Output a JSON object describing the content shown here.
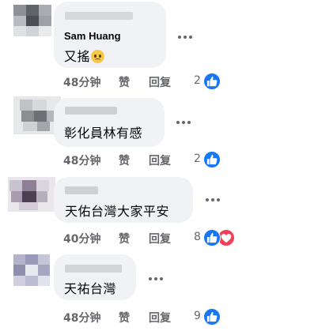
{
  "comments": [
    {
      "author": "Sam Huang",
      "text": "又搖",
      "emoji": "sad-face-emoji",
      "time": "48分钟",
      "like_label": "赞",
      "reply_label": "回复",
      "reaction_count": "2",
      "reactions": [
        "like"
      ]
    },
    {
      "author": "",
      "text": "彰化員林有感",
      "time": "48分钟",
      "like_label": "赞",
      "reply_label": "回复",
      "reaction_count": "2",
      "reactions": [
        "like"
      ]
    },
    {
      "author": "",
      "text": "天佑台灣大家平安",
      "time": "40分钟",
      "like_label": "赞",
      "reply_label": "回复",
      "reaction_count": "8",
      "reactions": [
        "like",
        "love"
      ]
    },
    {
      "author": "",
      "text": "天祐台灣",
      "time": "48分钟",
      "like_label": "赞",
      "reply_label": "回复",
      "reaction_count": "9",
      "reactions": [
        "like"
      ]
    }
  ],
  "colors": {
    "bubble": "#f0f2f5",
    "text": "#050505",
    "meta": "#65676b",
    "like_blue": "#1877f2",
    "love_red": "#f33e58"
  }
}
